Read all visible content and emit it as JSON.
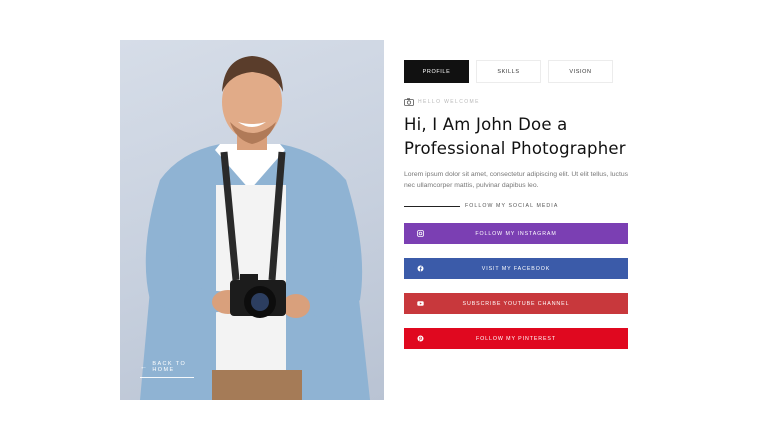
{
  "hero": {
    "back_label": "BACK TO HOME"
  },
  "tabs": [
    {
      "label": "PROFILE",
      "active": true
    },
    {
      "label": "SKILLS",
      "active": false
    },
    {
      "label": "VISION",
      "active": false
    }
  ],
  "profile": {
    "welcome": "HELLO WELCOME",
    "heading_line1": "Hi, I Am John Doe a",
    "heading_line2": "Professional Photographer",
    "intro": "Lorem ipsum dolor sit amet, consectetur adipiscing elit. Ut elit tellus, luctus nec ullamcorper mattis, pulvinar dapibus leo.",
    "follow_label": "FOLLOW MY SOCIAL MEDIA"
  },
  "social": [
    {
      "label": "FOLLOW MY INSTAGRAM",
      "icon": "instagram-icon",
      "color": "#7b3fb3"
    },
    {
      "label": "VISIT MY FACEBOOK",
      "icon": "facebook-icon",
      "color": "#3b5ba9"
    },
    {
      "label": "SUBSCRIBE YOUTUBE CHANNEL",
      "icon": "youtube-icon",
      "color": "#c8383c"
    },
    {
      "label": "FOLLOW MY PINTEREST",
      "icon": "pinterest-icon",
      "color": "#e0081f"
    }
  ],
  "colors": {
    "tab_active": "#111111",
    "text_dark": "#111111",
    "text_muted": "#777777"
  }
}
